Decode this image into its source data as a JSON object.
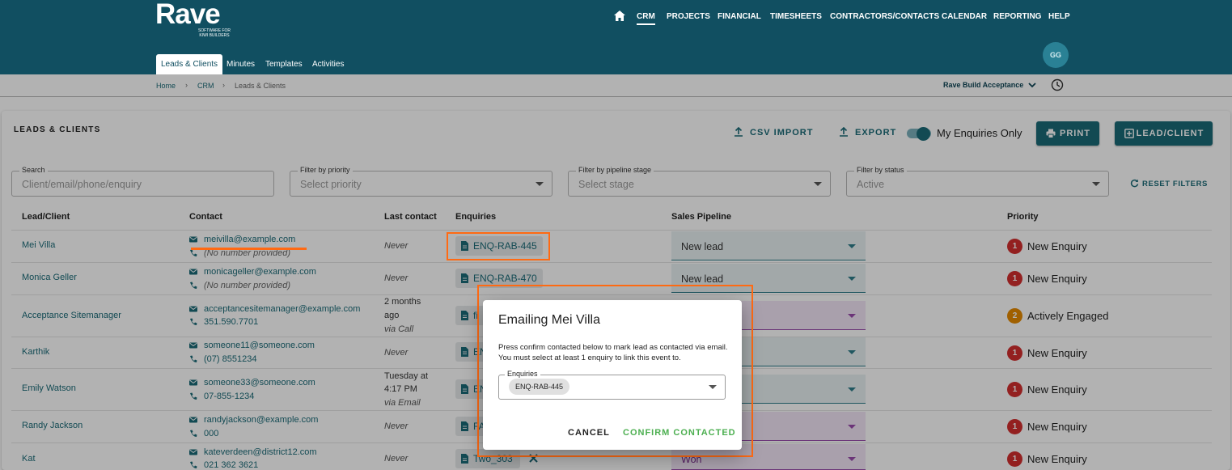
{
  "brand": {
    "name": "Rave",
    "tagline": "SOFTWARE FOR KIWI BUILDERS"
  },
  "nav": {
    "items": [
      "CRM",
      "PROJECTS",
      "FINANCIAL",
      "TIMESHEETS",
      "CONTRACTORS/CONTACTS",
      "CALENDAR",
      "REPORTING",
      "HELP"
    ],
    "active": "CRM"
  },
  "subtabs": [
    "Leads & Clients",
    "Minutes",
    "Templates",
    "Activities"
  ],
  "user": {
    "initials": "GG"
  },
  "breadcrumb": [
    "Home",
    "CRM",
    "Leads & Clients"
  ],
  "company": {
    "name": "Rave Build Acceptance"
  },
  "page": {
    "title": "LEADS & CLIENTS",
    "csv_import": "CSV IMPORT",
    "export": "EXPORT",
    "my_enquiries": "My Enquiries Only",
    "print": "PRINT",
    "add_lead": "LEAD/CLIENT"
  },
  "filters": {
    "search_label": "Search",
    "search_placeholder": "Client/email/phone/enquiry",
    "priority_label": "Filter by priority",
    "priority_value": "Select priority",
    "stage_label": "Filter by pipeline stage",
    "stage_value": "Select stage",
    "status_label": "Filter by status",
    "status_value": "Active",
    "reset": "RESET FILTERS"
  },
  "table": {
    "headers": [
      "Lead/Client",
      "Contact",
      "Last contact",
      "Enquiries",
      "Sales Pipeline",
      "Priority"
    ],
    "rows": [
      {
        "name": "Mei Villa",
        "email": "meivilla@example.com",
        "phone": "(No number provided)",
        "last": [
          "Never"
        ],
        "enquiry": "ENQ-RAB-445",
        "pipeline": "New lead",
        "priority_num": "1",
        "priority": "New Enquiry"
      },
      {
        "name": "Monica Geller",
        "email": "monicageller@example.com",
        "phone": "(No number provided)",
        "last": [
          "Never"
        ],
        "enquiry": "ENQ-RAB-470",
        "pipeline": "New lead",
        "priority_num": "1",
        "priority": "New Enquiry"
      },
      {
        "name": "Acceptance Sitemanager",
        "email": "acceptancesitemanager@example.com",
        "phone": "351.590.7701",
        "last": [
          "2 months",
          "ago",
          "via Call"
        ],
        "enquiry": "fi",
        "pipeline": "",
        "priority_num": "2",
        "priority": "Actively Engaged"
      },
      {
        "name": "Karthik",
        "email": "someone11@someone.com",
        "phone": "(07) 8551234",
        "last": [
          "Never"
        ],
        "enquiry": "EN",
        "pipeline": "",
        "priority_num": "1",
        "priority": "New Enquiry"
      },
      {
        "name": "Emily Watson",
        "email": "someone33@someone.com",
        "phone": "07-855-1234",
        "last": [
          "Tuesday at",
          "4:17 PM",
          "via Email"
        ],
        "enquiry": "EN",
        "pipeline": "",
        "priority_num": "1",
        "priority": "New Enquiry"
      },
      {
        "name": "Randy Jackson",
        "email": "randyjackson@example.com",
        "phone": "000",
        "last": [
          "Never"
        ],
        "enquiry": "FA",
        "pipeline": "",
        "priority_num": "1",
        "priority": "New Enquiry"
      },
      {
        "name": "Kat",
        "email": "kateverdeen@district12.com",
        "phone": "021 362 3621",
        "last": [
          "Never"
        ],
        "enquiry": "Two_303",
        "pipeline": "Won",
        "priority_num": "1",
        "priority": "New Enquiry"
      }
    ]
  },
  "dialog": {
    "title": "Emailing Mei Villa",
    "body": "Press confirm contacted below to mark lead as contacted via email. You must select at least 1 enquiry to link this event to.",
    "field_label": "Enquiries",
    "chip": "ENQ-RAB-445",
    "cancel": "CANCEL",
    "confirm": "CONFIRM CONTACTED"
  },
  "colors": {
    "header": "#114f61",
    "accent": "#1b6b78",
    "priority_new": "#d32f2f",
    "priority_engaged": "#e68a00",
    "confirm": "#4caf50",
    "highlight": "#ff6a13"
  }
}
